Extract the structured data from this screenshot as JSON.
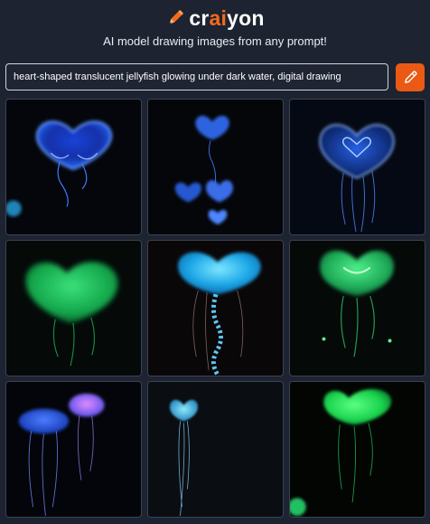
{
  "header": {
    "logo_icon": "pencil-icon",
    "logo_prefix": "cr",
    "logo_accent": "ai",
    "logo_suffix": "yon",
    "tagline": "AI model drawing images from any prompt!"
  },
  "search": {
    "value": "heart-shaped translucent jellyfish glowing under dark water, digital drawing",
    "draw_button_icon": "pencil-icon"
  },
  "colors": {
    "background": "#1d2330",
    "accent": "#ea5a14",
    "glow_blue": "#4d8dff",
    "glow_green": "#34e56a",
    "glow_cyan": "#5fd3ff"
  },
  "results": [
    {
      "description": "blue heart jellyfish"
    },
    {
      "description": "small blue heart jellyfish group"
    },
    {
      "description": "blue heart jellyfish with tentacles"
    },
    {
      "description": "green glowing heart jellyfish"
    },
    {
      "description": "cyan heart jellyfish"
    },
    {
      "description": "green heart jellyfish"
    },
    {
      "description": "blue and pink jellyfish"
    },
    {
      "description": "small cyan heart jellyfish"
    },
    {
      "description": "bright green heart jellyfish"
    }
  ]
}
